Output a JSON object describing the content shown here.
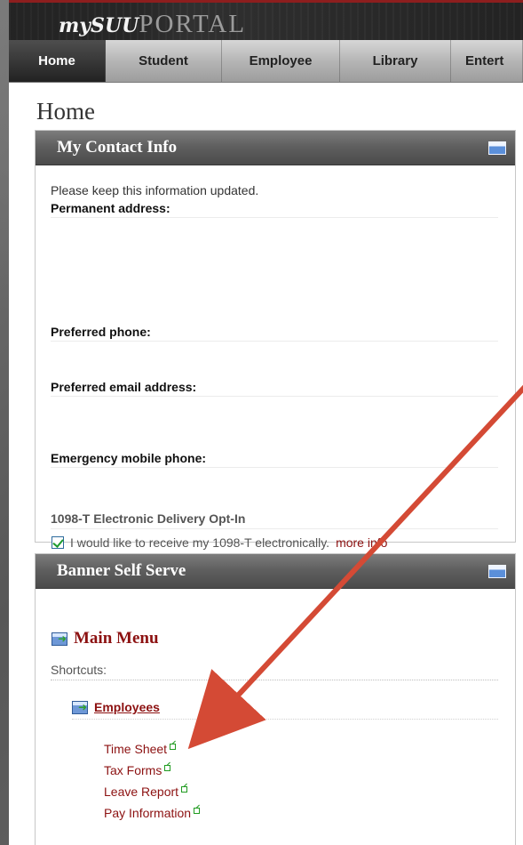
{
  "header": {
    "brand_prefix": "mySUU",
    "brand_suffix": "PORTAL"
  },
  "nav": {
    "tabs": [
      {
        "label": "Home",
        "active": true
      },
      {
        "label": "Student",
        "active": false
      },
      {
        "label": "Employee",
        "active": false
      },
      {
        "label": "Library",
        "active": false
      },
      {
        "label": "Entert",
        "active": false
      }
    ]
  },
  "page": {
    "title": "Home"
  },
  "contact": {
    "title": "My Contact Info",
    "intro": "Please keep this information updated.",
    "permanent_address": "Permanent address:",
    "preferred_phone": "Preferred phone:",
    "preferred_email": "Preferred email address:",
    "emergency_phone": "Emergency mobile phone:",
    "opt_in_title": "1098-T Electronic Delivery Opt-In",
    "opt_in_text": "I would like to receive my 1098-T electronically.",
    "more_info": "more info",
    "opt_in_checked": true
  },
  "banner": {
    "title": "Banner Self Serve",
    "main_menu": "Main Menu",
    "shortcuts": "Shortcuts:",
    "employees": "Employees",
    "links": [
      {
        "label": "Time Sheet"
      },
      {
        "label": "Tax Forms"
      },
      {
        "label": "Leave Report"
      },
      {
        "label": "Pay Information"
      }
    ]
  },
  "icons": {
    "panel_window": "window-icon",
    "menu": "menu-arrow-icon",
    "external": "external-link-icon",
    "annotation": "red-arrow"
  },
  "colors": {
    "accent": "#8c1111",
    "annotation": "#d44a35",
    "header_dark": "#222222"
  }
}
